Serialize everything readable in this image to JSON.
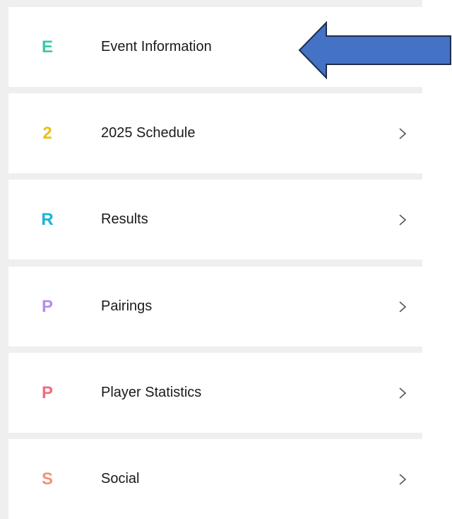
{
  "menu": {
    "items": [
      {
        "letter": "E",
        "label": "Event Information",
        "color": "#3cc8a8",
        "has_chevron": false
      },
      {
        "letter": "2",
        "label": "2025 Schedule",
        "color": "#e8c20e",
        "has_chevron": true
      },
      {
        "letter": "R",
        "label": "Results",
        "color": "#1ab3d6",
        "has_chevron": true
      },
      {
        "letter": "P",
        "label": "Pairings",
        "color": "#b38cf2",
        "has_chevron": true
      },
      {
        "letter": "P",
        "label": "Player Statistics",
        "color": "#f26a80",
        "has_chevron": true
      },
      {
        "letter": "S",
        "label": "Social",
        "color": "#f2937a",
        "has_chevron": true
      }
    ]
  },
  "annotation": {
    "icon": "left-arrow-icon",
    "fill": "#4472c4",
    "stroke": "#1f2d4e"
  }
}
